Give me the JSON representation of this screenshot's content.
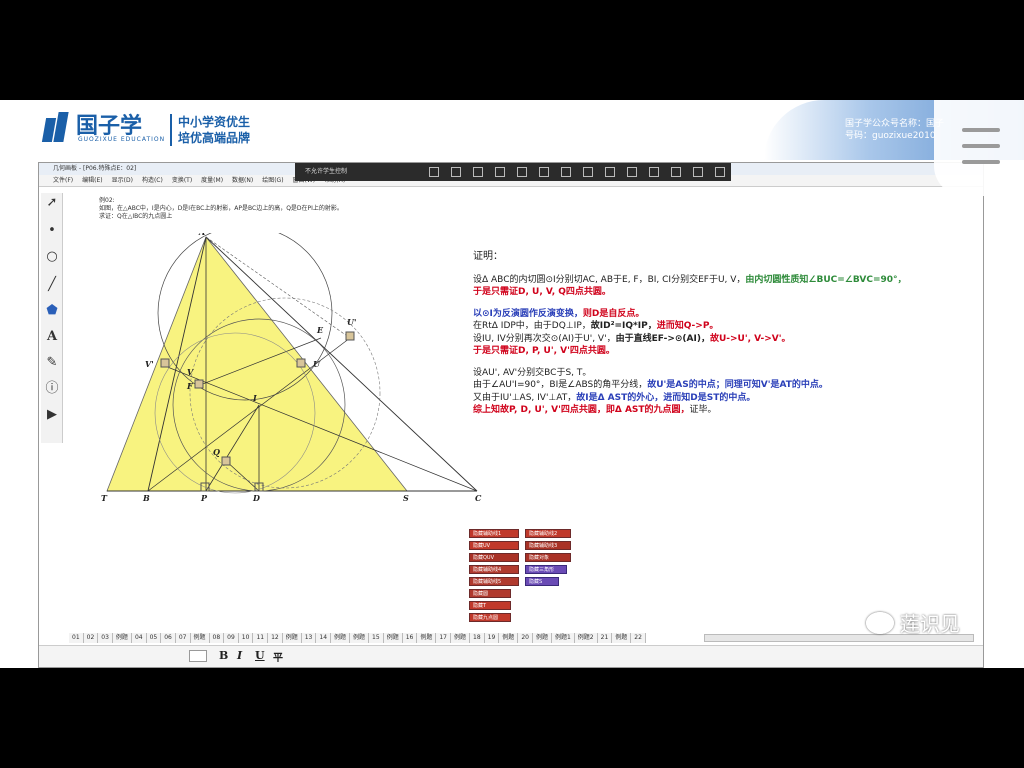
{
  "banner": {
    "logo_text": "国子学",
    "logo_sub": "GUOZIXUE EDUCATION",
    "slogan_line1": "中小学资优生",
    "slogan_line2": "培优高端品牌",
    "account_line1": "国子学公众号名称：国子",
    "account_line2": "号码：guozixue2010"
  },
  "window": {
    "title": "几何画板 - [P06.特殊点E：02]",
    "menus": [
      "文件(F)",
      "编辑(E)",
      "显示(D)",
      "构造(C)",
      "变换(T)",
      "度量(M)",
      "数据(N)",
      "绘图(G)",
      "窗口(W)",
      "帮助(H)"
    ],
    "float_toolbar_label": "不允许学生控制"
  },
  "problem": {
    "line1": "例02:",
    "line2": "如图，在△ABC中，I是内心，D是I在BC上的射影，AP是BC边上的高，Q是D在PI上的射影。",
    "line3": "求证：Q在△IBC的九点圆上"
  },
  "proof": {
    "title": "证明：",
    "l1a": "设Δ ABC的内切圆⊙I分别切AC, AB于E, F，BI, CI分别交EF于U, V，",
    "l1b": "由内切圆性质知∠BUC=∠BVC=90°，",
    "l2": "于是只需证D, U, V, Q四点共圆。",
    "l3a": "以⊙I为反演圆作反演变换，",
    "l3b": "则D是自反点。",
    "l4a": "在RtΔ IDP中，由于DQ⊥IP，",
    "l4b": "故ID²=IQ*IP，",
    "l4c": "进而知Q->P。",
    "l5a": "设IU, IV分别再次交⊙(AI)于U', V'，",
    "l5b": "由于直线EF->⊙(AI)，",
    "l5c": "故U->U', V->V'。",
    "l6": "于是只需证D, P, U', V'四点共圆。",
    "l7": "设AU', AV'分别交BC于S, T。",
    "l8a": "由于∠AU'I=90°，BI是∠ABS的角平分线，",
    "l8b": "故U'是AS的中点；",
    "l8c": "同理可知V'是AT的中点。",
    "l9a": "又由于IU'⊥AS, IV'⊥AT，",
    "l9b": "故I是Δ AST的外心，",
    "l9c": "进而知D是ST的中点。",
    "l10a": "综上知故P, D, U', V'四点共圆，",
    "l10b": "即Δ AST的九点圆，",
    "l10c": "证毕。"
  },
  "points": {
    "A": "A",
    "B": "B",
    "C": "C",
    "D": "D",
    "P": "P",
    "Q": "Q",
    "I": "I",
    "E": "E",
    "F": "F",
    "U": "U",
    "V": "V",
    "U2": "U'",
    "V2": "V'",
    "S": "S",
    "T": "T"
  },
  "buttons": [
    {
      "label": "隐藏辅助线1",
      "color": "#c0392b"
    },
    {
      "label": "隐藏辅助线2",
      "color": "#c0392b"
    },
    {
      "label": "隐藏UV",
      "color": "#c0392b"
    },
    {
      "label": "隐藏辅助线3",
      "color": "#a93226"
    },
    {
      "label": "隐藏QUV",
      "color": "#a93226"
    },
    {
      "label": "隐藏对象",
      "color": "#a93226"
    },
    {
      "label": "隐藏辅助线4",
      "color": "#b03a2e"
    },
    {
      "label": "隐藏三角形",
      "color": "#6a4bb5"
    },
    {
      "label": "隐藏辅助线5",
      "color": "#b03a2e"
    },
    {
      "label": "隐藏S",
      "color": "#6a4bb5"
    },
    {
      "label": "隐藏圆",
      "color": "#b03a2e"
    },
    {
      "label": "隐藏T",
      "color": "#c0392b"
    },
    {
      "label": "隐藏九点圆",
      "color": "#c0392b"
    }
  ],
  "tabs": [
    "01",
    "02",
    "03",
    "例题",
    "04",
    "05",
    "06",
    "07",
    "例题",
    "08",
    "09",
    "10",
    "11",
    "12",
    "例题",
    "13",
    "14",
    "例题",
    "例题",
    "15",
    "例题",
    "16",
    "例题",
    "17",
    "例题",
    "18",
    "19",
    "例题",
    "20",
    "例题",
    "例题1",
    "例题2",
    "21",
    "例题",
    "22"
  ],
  "format_buttons": {
    "bold": "B",
    "italic": "I",
    "underline": "U",
    "special": "平"
  },
  "watermark": "莲识见"
}
